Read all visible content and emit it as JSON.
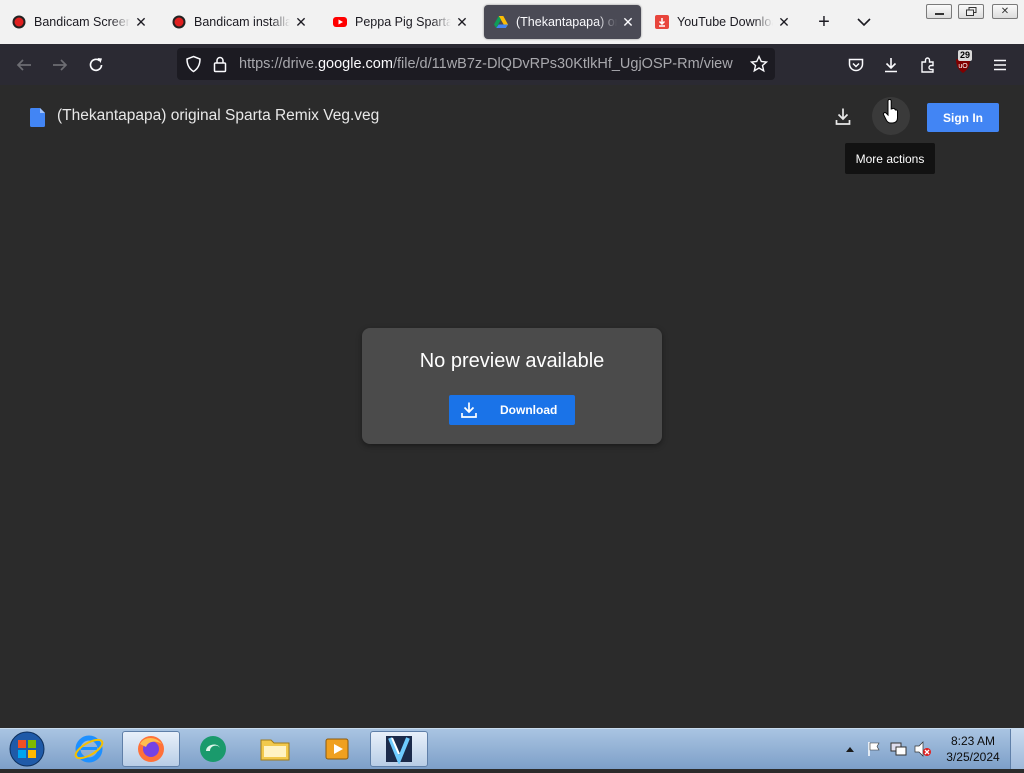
{
  "browser": {
    "tabs": [
      {
        "title": "Bandicam Screen Re",
        "favicon": "bandicam-icon",
        "active": false
      },
      {
        "title": "Bandicam installation",
        "favicon": "bandicam-icon",
        "active": false
      },
      {
        "title": "Peppa Pig Sparta De",
        "favicon": "youtube-icon",
        "active": false
      },
      {
        "title": "(Thekantapapa) orig",
        "favicon": "google-drive-icon",
        "active": true
      },
      {
        "title": "YouTube Downloader",
        "favicon": "download-icon",
        "active": false
      }
    ],
    "url": {
      "prefix": "https://drive.",
      "domain": "google.com",
      "path": "/file/d/11wB7z-DlQDvRPs30KtlkHf_UgjOSP-Rm/view"
    },
    "extension_badge": "29"
  },
  "drive": {
    "file_title": "(Thekantapapa) original Sparta Remix Veg.veg",
    "sign_in_label": "Sign In",
    "tooltip": "More actions",
    "no_preview_text": "No preview available",
    "download_label": "Download"
  },
  "taskbar": {
    "time": "8:23 AM",
    "date": "3/25/2024"
  },
  "colors": {
    "page_bg": "#2b2b2b",
    "accent_blue": "#1a73e8",
    "signin_blue": "#4285f4"
  }
}
